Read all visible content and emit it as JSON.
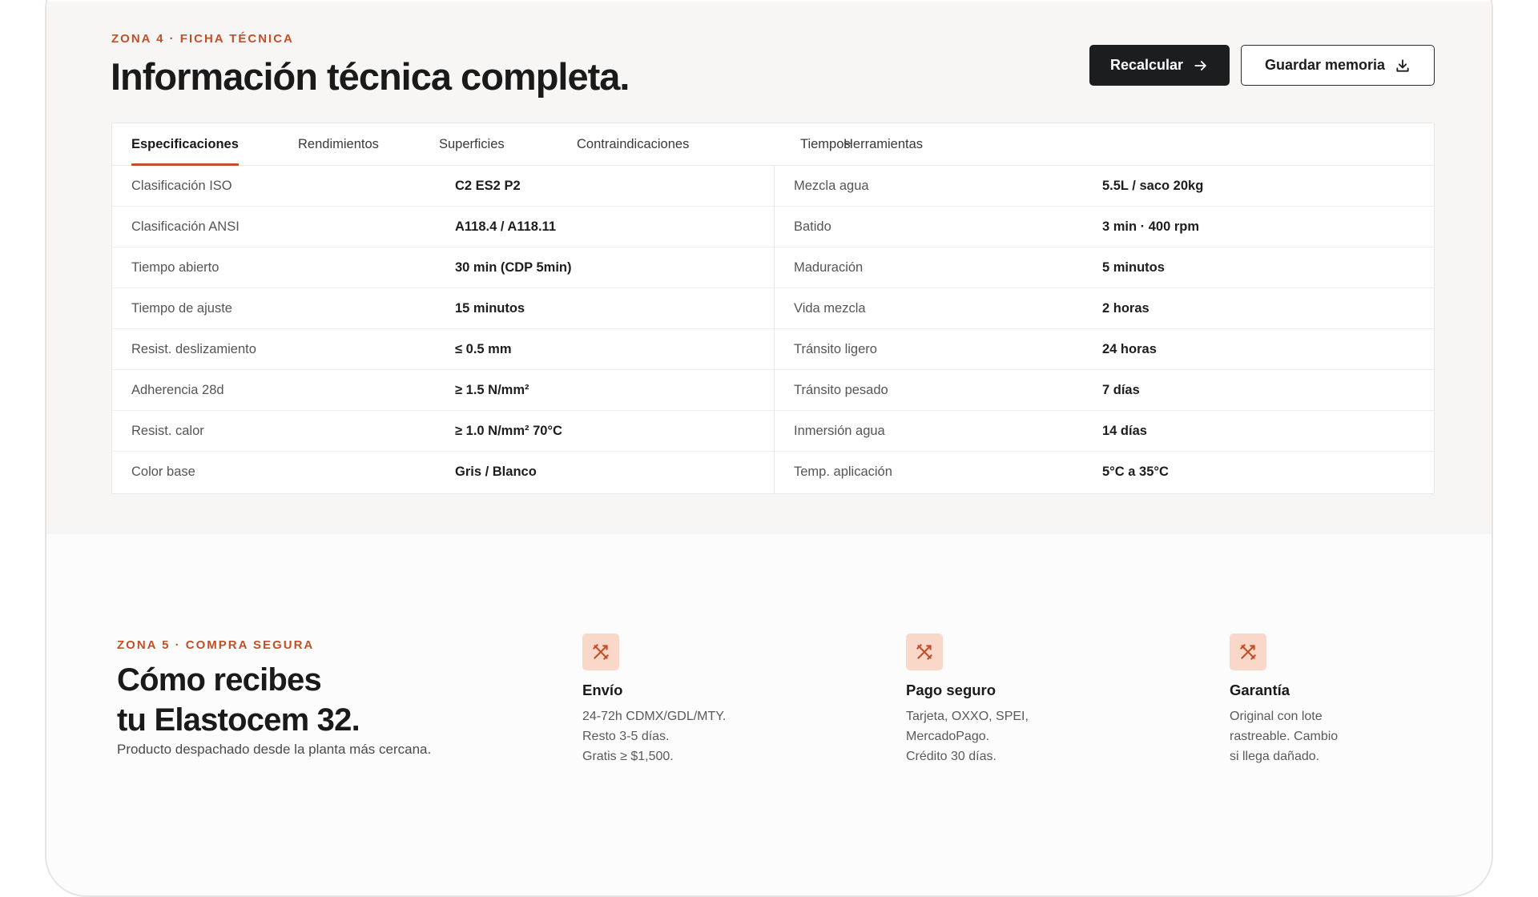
{
  "zone4": {
    "eyebrow": "ZONA 4 · FICHA TÉCNICA",
    "title": "Información técnica completa.",
    "recalc_label": "Recalcular",
    "save_label": "Guardar memoria",
    "tabs": [
      "Especificaciones",
      "Rendimientos",
      "Superficies",
      "Contraindicaciones",
      "Tiempos",
      "Herramientas"
    ],
    "active_tab": "Especificaciones",
    "left_rows": [
      {
        "label": "Clasificación ISO",
        "value": "C2 ES2 P2"
      },
      {
        "label": "Clasificación ANSI",
        "value": "A118.4 / A118.11"
      },
      {
        "label": "Tiempo abierto",
        "value": "30 min (CDP 5min)"
      },
      {
        "label": "Tiempo de ajuste",
        "value": "15 minutos"
      },
      {
        "label": "Resist. deslizamiento",
        "value": "≤ 0.5 mm"
      },
      {
        "label": "Adherencia 28d",
        "value": "≥ 1.5 N/mm²"
      },
      {
        "label": "Resist. calor",
        "value": "≥ 1.0 N/mm² 70°C"
      },
      {
        "label": "Color base",
        "value": "Gris / Blanco"
      }
    ],
    "right_rows": [
      {
        "label": "Mezcla agua",
        "value": "5.5L / saco 20kg"
      },
      {
        "label": "Batido",
        "value": "3 min · 400 rpm"
      },
      {
        "label": "Maduración",
        "value": "5 minutos"
      },
      {
        "label": "Vida mezcla",
        "value": "2 horas"
      },
      {
        "label": "Tránsito ligero",
        "value": "24 horas"
      },
      {
        "label": "Tránsito pesado",
        "value": "7 días"
      },
      {
        "label": "Inmersión agua",
        "value": "14 días"
      },
      {
        "label": "Temp. aplicación",
        "value": "5°C a 35°C"
      }
    ]
  },
  "zone5": {
    "eyebrow": "ZONA 5 · COMPRA SEGURA",
    "title_line1": "Cómo recibes",
    "title_line2": "tu Elastocem 32.",
    "subtitle": "Producto despachado desde la planta más cercana.",
    "features": [
      {
        "icon": "tools-icon",
        "title": "Envío",
        "lines": [
          "24-72h CDMX/GDL/MTY.",
          "Resto 3-5 días.",
          "Gratis ≥ $1,500."
        ]
      },
      {
        "icon": "tools-icon",
        "title": "Pago seguro",
        "lines": [
          "Tarjeta, OXXO, SPEI,",
          "MercadoPago.",
          "Crédito 30 días."
        ]
      },
      {
        "icon": "tools-icon",
        "title": "Garantía",
        "lines": [
          "Original con lote",
          "rastreable. Cambio",
          "si llega dañado."
        ]
      }
    ]
  },
  "colors": {
    "accent": "#c0502a",
    "icon_bg": "#f9d7c9",
    "dark_button": "#1b1d1f"
  }
}
